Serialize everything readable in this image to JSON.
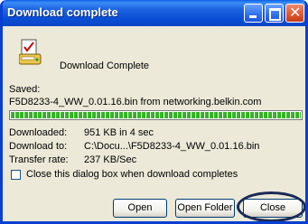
{
  "window": {
    "title": "Download complete",
    "controls": {
      "minimize": "minimize-icon",
      "maximize": "maximize-icon",
      "close": "close-icon"
    }
  },
  "header": {
    "icon": "download-complete-icon",
    "label": "Download Complete"
  },
  "saved": {
    "label": "Saved:",
    "source": "F5D8233-4_WW_0.01.16.bin from networking.belkin.com"
  },
  "progress": {
    "percent": 100,
    "color": "#3fbf2f"
  },
  "details": [
    {
      "label": "Downloaded:",
      "value": "951 KB in 4 sec"
    },
    {
      "label": "Download to:",
      "value": "C:\\Docu...\\F5D8233-4_WW_0.01.16.bin"
    },
    {
      "label": "Transfer rate:",
      "value": "237 KB/Sec"
    }
  ],
  "close_checkbox": {
    "label": "Close this dialog box when download completes",
    "checked": false
  },
  "buttons": {
    "open": "Open",
    "open_folder": "Open Folder",
    "close": "Close"
  },
  "colors": {
    "titlebar": "#0a4fd6",
    "dialog_bg": "#ece9d8",
    "border": "#0a3fd1"
  }
}
